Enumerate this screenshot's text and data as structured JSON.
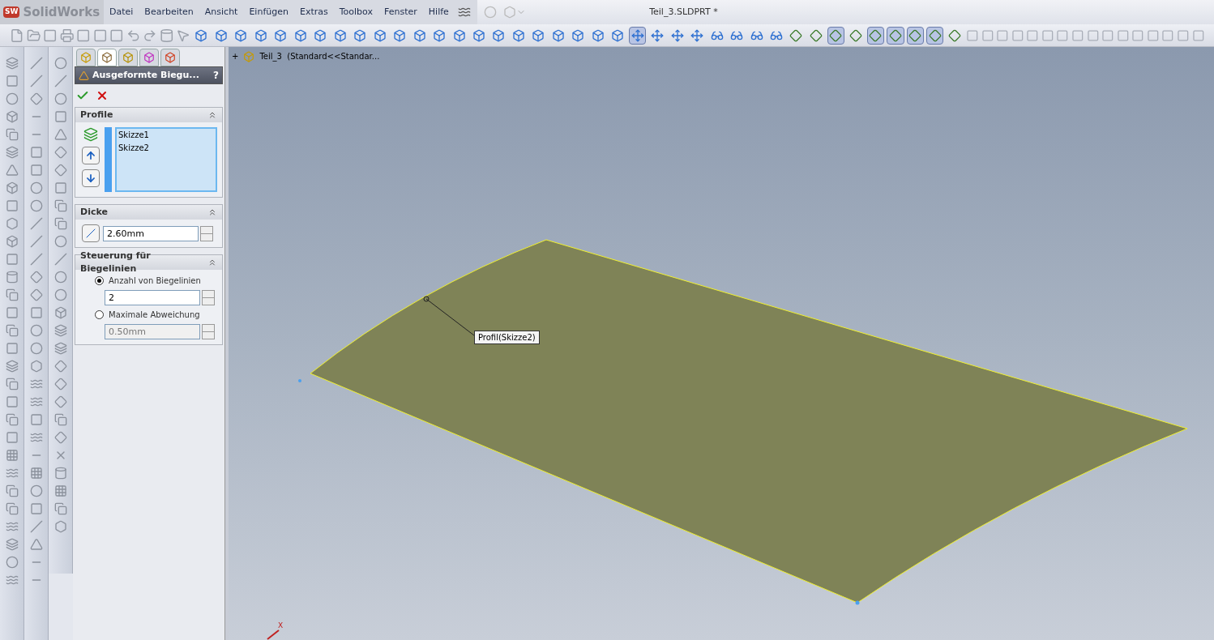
{
  "app": {
    "logo_badge": "SW",
    "logo_text": "SolidWorks"
  },
  "menu": [
    "Datei",
    "Bearbeiten",
    "Ansicht",
    "Einfügen",
    "Extras",
    "Toolbox",
    "Fenster",
    "Hilfe"
  ],
  "window": {
    "title": "Teil_3.SLDPRT *"
  },
  "toolbar": [
    {
      "pressed": false
    },
    {
      "pressed": false
    },
    {
      "pressed": false
    },
    {
      "pressed": false
    },
    {
      "pressed": false
    },
    {
      "pressed": false
    },
    {
      "pressed": false
    },
    {
      "pressed": false
    },
    {
      "pressed": false
    },
    {
      "pressed": false
    },
    {
      "pressed": false
    },
    {
      "pressed": false
    },
    {
      "pressed": false
    },
    {
      "pressed": false
    },
    {
      "pressed": false
    },
    {
      "pressed": false
    },
    {
      "pressed": false
    },
    {
      "pressed": false
    },
    {
      "pressed": false
    },
    {
      "pressed": false
    },
    {
      "pressed": false
    },
    {
      "pressed": false
    },
    {
      "pressed": true
    },
    {
      "pressed": false
    },
    {
      "pressed": false
    },
    {
      "pressed": false
    },
    {
      "pressed": false
    },
    {
      "pressed": false
    },
    {
      "pressed": false
    },
    {
      "pressed": false
    },
    {
      "pressed": false
    },
    {
      "pressed": false
    },
    {
      "pressed": true
    },
    {
      "pressed": false
    },
    {
      "pressed": true
    },
    {
      "pressed": true
    },
    {
      "pressed": true
    },
    {
      "pressed": true
    },
    {
      "pressed": false
    }
  ],
  "panel_tabs": [
    {
      "selected": false
    },
    {
      "selected": true
    },
    {
      "selected": false
    },
    {
      "selected": false
    },
    {
      "selected": false
    }
  ],
  "property_manager": {
    "title": "Ausgeformte Biegu...",
    "help": "?",
    "sections": [
      {
        "kind": "list",
        "title": "Profile",
        "items": [
          "Skizze1",
          "Skizze2"
        ]
      },
      {
        "kind": "thickness",
        "title": "Dicke",
        "value": "2.60mm"
      },
      {
        "kind": "options",
        "title": "Steuerung für Biegelinien",
        "options": [
          {
            "label": "Anzahl von Biegelinien",
            "selected": true,
            "value": "2"
          },
          {
            "label": "Maximale Abweichung",
            "selected": false,
            "value": "0.50mm"
          }
        ]
      }
    ]
  },
  "feature_tree": {
    "expander": "+",
    "label": "Teil_3  (Standard<<Standar..."
  },
  "viewport": {
    "callout": "Profil(Skizze2)",
    "axis_label": "X"
  }
}
